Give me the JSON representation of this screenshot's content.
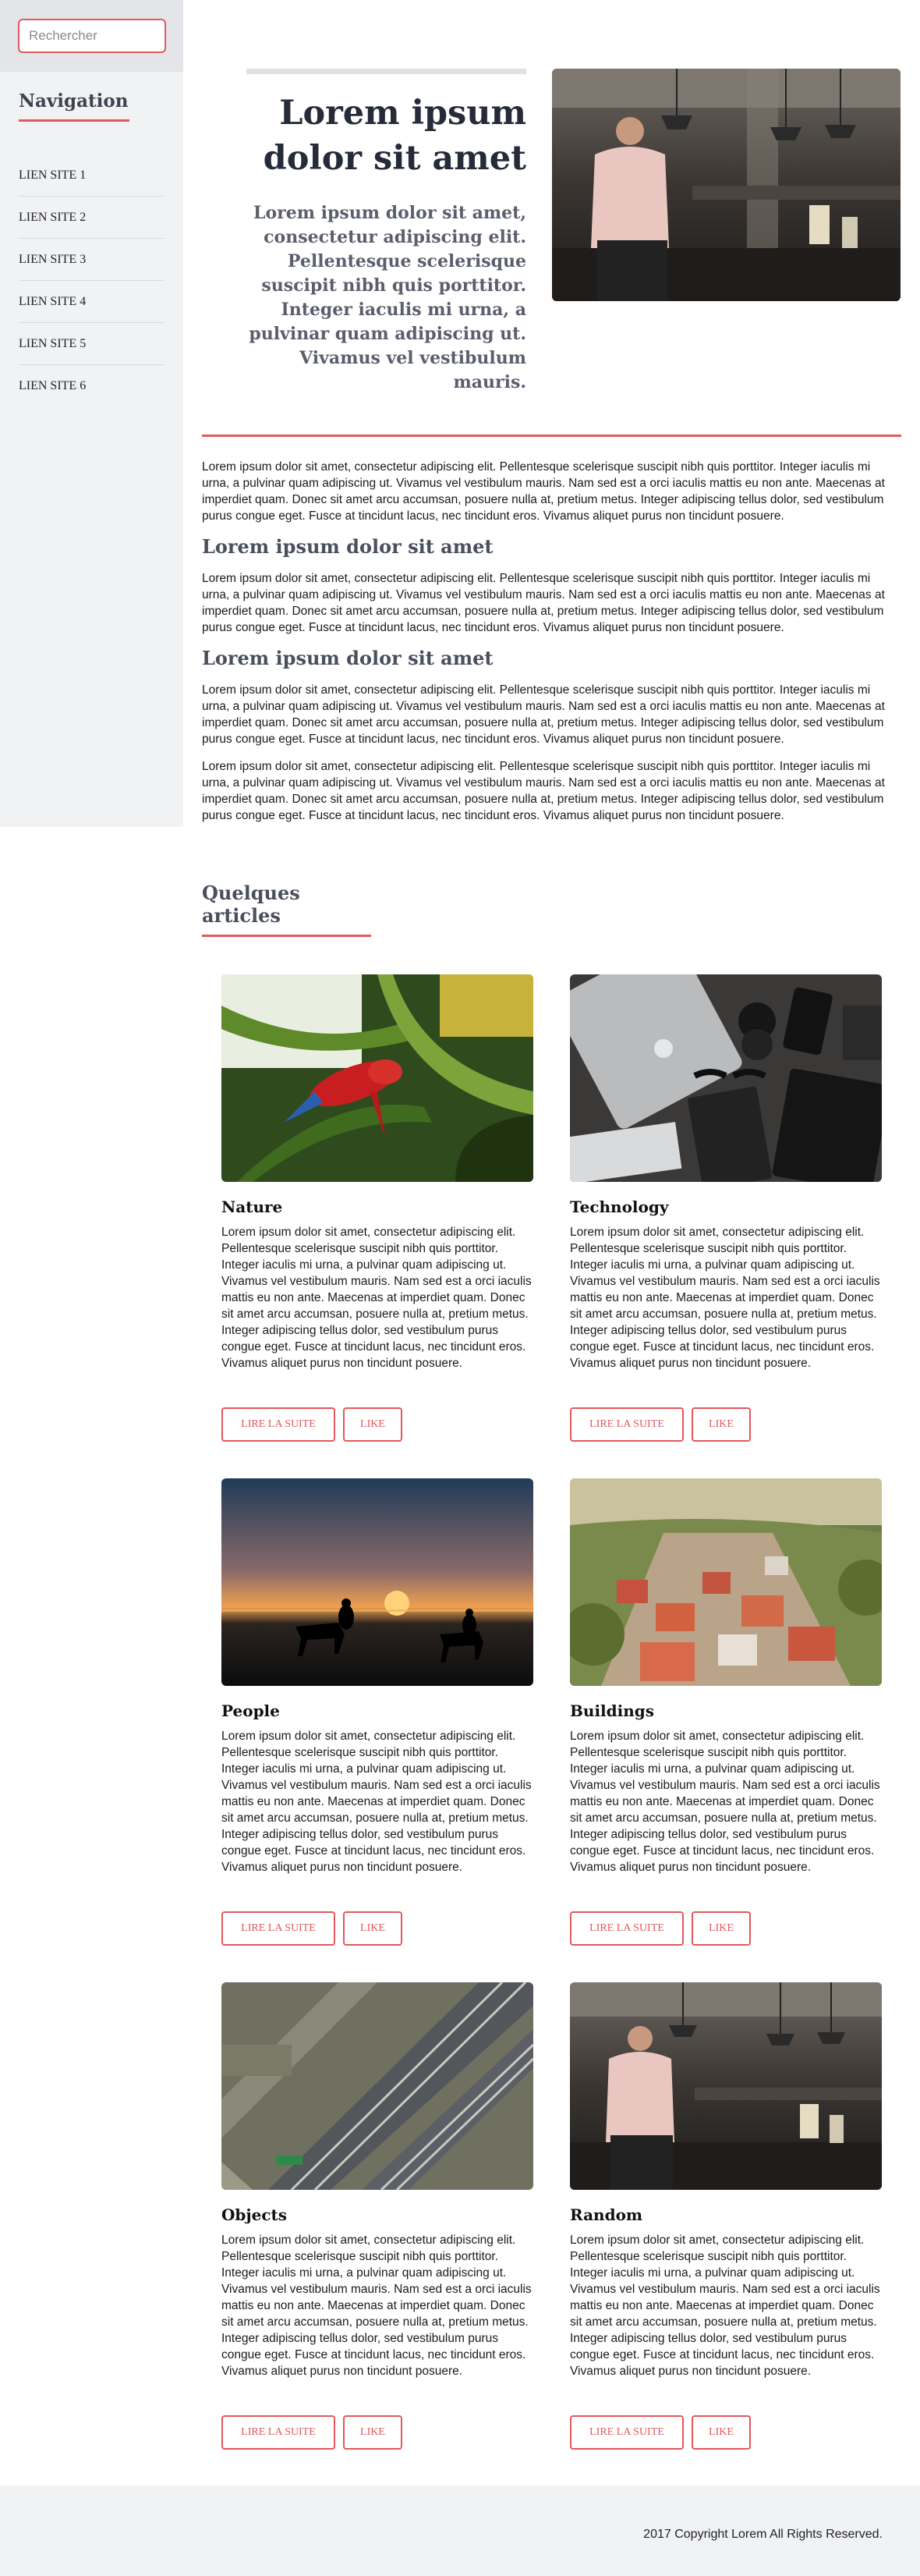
{
  "search": {
    "placeholder": "Rechercher"
  },
  "sidebar": {
    "title": "Navigation",
    "items": [
      {
        "label": "LIEN SITE 1"
      },
      {
        "label": "LIEN SITE 2"
      },
      {
        "label": "LIEN SITE 3"
      },
      {
        "label": "LIEN SITE 4"
      },
      {
        "label": "LIEN SITE 5"
      },
      {
        "label": "LIEN SITE 6"
      }
    ]
  },
  "hero": {
    "title": "Lorem ipsum dolor sit amet",
    "subtitle": "Lorem ipsum dolor sit amet, consectetur adipiscing elit. Pellentesque scelerisque suscipit nibh quis porttitor. Integer iaculis mi urna, a pulvinar quam adipiscing ut. Vivamus vel vestibulum mauris."
  },
  "article": {
    "intro": "Lorem ipsum dolor sit amet, consectetur adipiscing elit. Pellentesque scelerisque suscipit nibh quis porttitor. Integer iaculis mi urna, a pulvinar quam adipiscing ut. Vivamus vel vestibulum mauris. Nam sed est a orci iaculis mattis eu non ante. Maecenas at imperdiet quam. Donec sit amet arcu accumsan, posuere nulla at, pretium metus. Integer adipiscing tellus dolor, sed vestibulum purus congue eget. Fusce at tincidunt lacus, nec tincidunt eros. Vivamus aliquet purus non tincidunt posuere.",
    "heading1": "Lorem ipsum dolor sit amet",
    "para1": "Lorem ipsum dolor sit amet, consectetur adipiscing elit. Pellentesque scelerisque suscipit nibh quis porttitor. Integer iaculis mi urna, a pulvinar quam adipiscing ut. Vivamus vel vestibulum mauris. Nam sed est a orci iaculis mattis eu non ante. Maecenas at imperdiet quam. Donec sit amet arcu accumsan, posuere nulla at, pretium metus. Integer adipiscing tellus dolor, sed vestibulum purus congue eget. Fusce at tincidunt lacus, nec tincidunt eros. Vivamus aliquet purus non tincidunt posuere.",
    "heading2": "Lorem ipsum dolor sit amet",
    "para2": "Lorem ipsum dolor sit amet, consectetur adipiscing elit. Pellentesque scelerisque suscipit nibh quis porttitor. Integer iaculis mi urna, a pulvinar quam adipiscing ut. Vivamus vel vestibulum mauris. Nam sed est a orci iaculis mattis eu non ante. Maecenas at imperdiet quam. Donec sit amet arcu accumsan, posuere nulla at, pretium metus. Integer adipiscing tellus dolor, sed vestibulum purus congue eget. Fusce at tincidunt lacus, nec tincidunt eros. Vivamus aliquet purus non tincidunt posuere.",
    "para3": "Lorem ipsum dolor sit amet, consectetur adipiscing elit. Pellentesque scelerisque suscipit nibh quis porttitor. Integer iaculis mi urna, a pulvinar quam adipiscing ut. Vivamus vel vestibulum mauris. Nam sed est a orci iaculis mattis eu non ante. Maecenas at imperdiet quam. Donec sit amet arcu accumsan, posuere nulla at, pretium metus. Integer adipiscing tellus dolor, sed vestibulum purus congue eget. Fusce at tincidunt lacus, nec tincidunt eros. Vivamus aliquet purus non tincidunt posuere."
  },
  "articles_section": {
    "title": "Quelques articles"
  },
  "cards": [
    {
      "title": "Nature",
      "text": "Lorem ipsum dolor sit amet, consectetur adipiscing elit. Pellentesque scelerisque suscipit nibh quis porttitor. Integer iaculis mi urna, a pulvinar quam adipiscing ut. Vivamus vel vestibulum mauris. Nam sed est a orci iaculis mattis eu non ante. Maecenas at imperdiet quam. Donec sit amet arcu accumsan, posuere nulla at, pretium metus. Integer adipiscing tellus dolor, sed vestibulum purus congue eget. Fusce at tincidunt lacus, nec tincidunt eros. Vivamus aliquet purus non tincidunt posuere.",
      "read_label": "LIRE LA SUITE",
      "like_label": "LIKE"
    },
    {
      "title": "Technology",
      "text": "Lorem ipsum dolor sit amet, consectetur adipiscing elit. Pellentesque scelerisque suscipit nibh quis porttitor. Integer iaculis mi urna, a pulvinar quam adipiscing ut. Vivamus vel vestibulum mauris. Nam sed est a orci iaculis mattis eu non ante. Maecenas at imperdiet quam. Donec sit amet arcu accumsan, posuere nulla at, pretium metus. Integer adipiscing tellus dolor, sed vestibulum purus congue eget. Fusce at tincidunt lacus, nec tincidunt eros. Vivamus aliquet purus non tincidunt posuere.",
      "read_label": "LIRE LA SUITE",
      "like_label": "LIKE"
    },
    {
      "title": "People",
      "text": "Lorem ipsum dolor sit amet, consectetur adipiscing elit. Pellentesque scelerisque suscipit nibh quis porttitor. Integer iaculis mi urna, a pulvinar quam adipiscing ut. Vivamus vel vestibulum mauris. Nam sed est a orci iaculis mattis eu non ante. Maecenas at imperdiet quam. Donec sit amet arcu accumsan, posuere nulla at, pretium metus. Integer adipiscing tellus dolor, sed vestibulum purus congue eget. Fusce at tincidunt lacus, nec tincidunt eros. Vivamus aliquet purus non tincidunt posuere.",
      "read_label": "LIRE LA SUITE",
      "like_label": "LIKE"
    },
    {
      "title": "Buildings",
      "text": "Lorem ipsum dolor sit amet, consectetur adipiscing elit. Pellentesque scelerisque suscipit nibh quis porttitor. Integer iaculis mi urna, a pulvinar quam adipiscing ut. Vivamus vel vestibulum mauris. Nam sed est a orci iaculis mattis eu non ante. Maecenas at imperdiet quam. Donec sit amet arcu accumsan, posuere nulla at, pretium metus. Integer adipiscing tellus dolor, sed vestibulum purus congue eget. Fusce at tincidunt lacus, nec tincidunt eros. Vivamus aliquet purus non tincidunt posuere.",
      "read_label": "LIRE LA SUITE",
      "like_label": "LIKE"
    },
    {
      "title": "Objects",
      "text": "Lorem ipsum dolor sit amet, consectetur adipiscing elit. Pellentesque scelerisque suscipit nibh quis porttitor. Integer iaculis mi urna, a pulvinar quam adipiscing ut. Vivamus vel vestibulum mauris. Nam sed est a orci iaculis mattis eu non ante. Maecenas at imperdiet quam. Donec sit amet arcu accumsan, posuere nulla at, pretium metus. Integer adipiscing tellus dolor, sed vestibulum purus congue eget. Fusce at tincidunt lacus, nec tincidunt eros. Vivamus aliquet purus non tincidunt posuere.",
      "read_label": "LIRE LA SUITE",
      "like_label": "LIKE"
    },
    {
      "title": "Random",
      "text": "Lorem ipsum dolor sit amet, consectetur adipiscing elit. Pellentesque scelerisque suscipit nibh quis porttitor. Integer iaculis mi urna, a pulvinar quam adipiscing ut. Vivamus vel vestibulum mauris. Nam sed est a orci iaculis mattis eu non ante. Maecenas at imperdiet quam. Donec sit amet arcu accumsan, posuere nulla at, pretium metus. Integer adipiscing tellus dolor, sed vestibulum purus congue eget. Fusce at tincidunt lacus, nec tincidunt eros. Vivamus aliquet purus non tincidunt posuere.",
      "read_label": "LIRE LA SUITE",
      "like_label": "LIKE"
    }
  ],
  "footer": {
    "text": "2017 Copyright Lorem All Rights Reserved."
  },
  "colors": {
    "accent": "#e2585c",
    "heading": "#262b3a",
    "sidebar_bg": "#f1f2f4"
  }
}
